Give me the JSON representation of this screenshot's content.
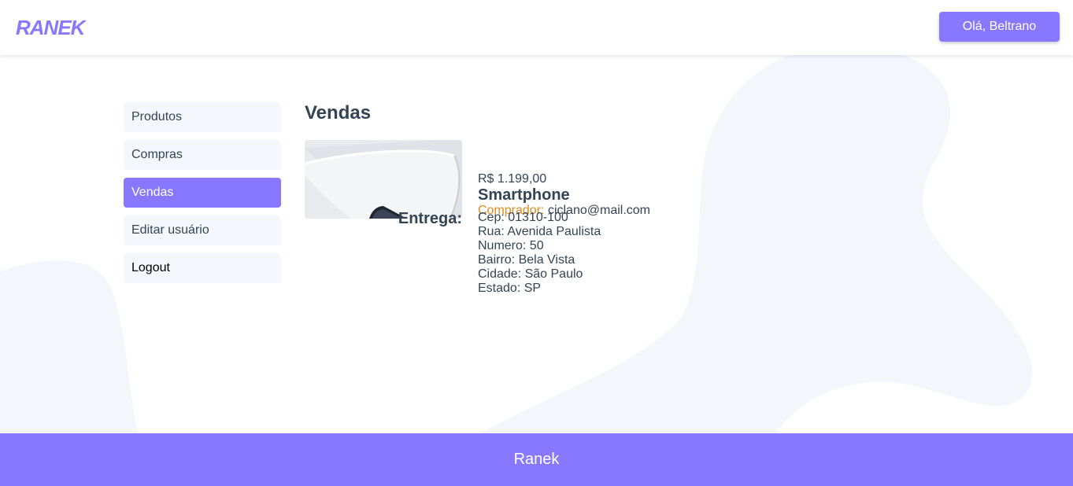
{
  "header": {
    "logo_text": "RANEK",
    "user_button_label": "Olá, Beltrano"
  },
  "sidebar": {
    "items": [
      {
        "label": "Produtos"
      },
      {
        "label": "Compras"
      },
      {
        "label": "Vendas"
      },
      {
        "label": "Editar usuário"
      },
      {
        "label": "Logout"
      }
    ]
  },
  "main": {
    "title": "Vendas",
    "sale": {
      "price": "R$ 1.199,00",
      "product_name": "Smartphone",
      "buyer_label": "Comprador:",
      "buyer_email": "ciclano@mail.com"
    },
    "delivery": {
      "label": "Entrega:",
      "cep": "Cep: 01310-100",
      "rua": "Rua: Avenida Paulista",
      "numero": "Numero: 50",
      "bairro": "Bairro: Bela Vista",
      "cidade": "Cidade: São Paulo",
      "estado": "Estado: SP"
    }
  },
  "footer": {
    "text": "Ranek"
  },
  "colors": {
    "accent": "#8877ff",
    "buyer_label": "#e08a1e",
    "text": "#334455",
    "nav_bg": "#f4f7fc",
    "background_shape": "#f3f6fb"
  }
}
